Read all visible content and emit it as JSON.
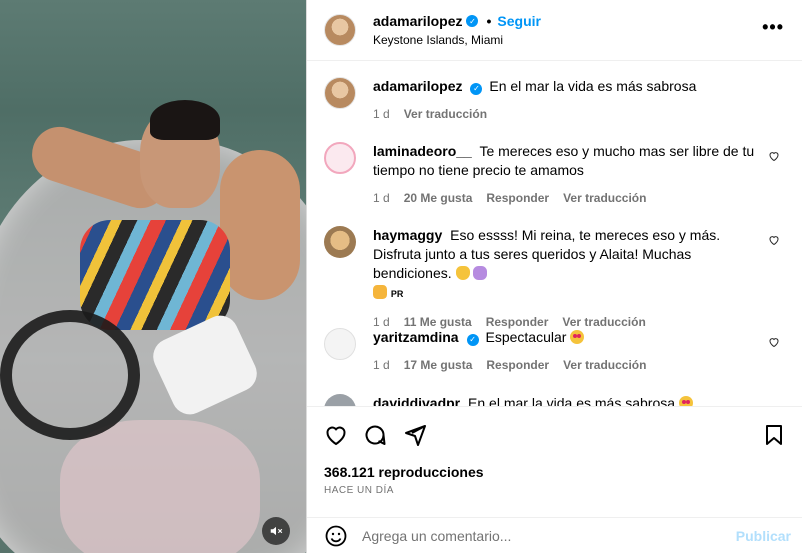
{
  "post": {
    "author": "adamarilopez",
    "follow_label": "Seguir",
    "separator": "•",
    "location": "Keystone Islands, Miami",
    "more_label": "•••"
  },
  "comments": [
    {
      "user": "adamarilopez",
      "verified": true,
      "text": "En el mar la vida es más sabrosa",
      "time": "1 d",
      "likes": "",
      "reply_label": "",
      "translate_label": "Ver traducción"
    },
    {
      "user": "laminadeoro__",
      "text": "Te mereces eso y mucho mas ser libre de tu tiempo no tiene precio te amamos",
      "time": "1 d",
      "likes": "20 Me gusta",
      "reply_label": "Responder",
      "translate_label": "Ver traducción"
    },
    {
      "user": "haymaggy",
      "text": "Eso essss! Mi reina, te mereces eso y más. Disfruta junto a tus seres queridos y Alaita! Muchas bendiciones.",
      "text_suffix": "PR",
      "time": "1 d",
      "likes": "11 Me gusta",
      "reply_label": "Responder",
      "translate_label": "Ver traducción"
    },
    {
      "user": "yaritzamdina",
      "verified": true,
      "text": "Espectacular",
      "time": "1 d",
      "likes": "17 Me gusta",
      "reply_label": "Responder",
      "translate_label": "Ver traducción"
    },
    {
      "user": "daviddivadpr",
      "text": "En el mar la vida es más sabrosa"
    }
  ],
  "stats": {
    "views": "368.121 reproducciones",
    "posted": "HACE UN DÍA"
  },
  "composer": {
    "placeholder": "Agrega un comentario...",
    "post_label": "Publicar"
  },
  "colors": {
    "link_blue": "#0095f6",
    "muted": "#737373",
    "post_disabled": "#b2dffc"
  }
}
